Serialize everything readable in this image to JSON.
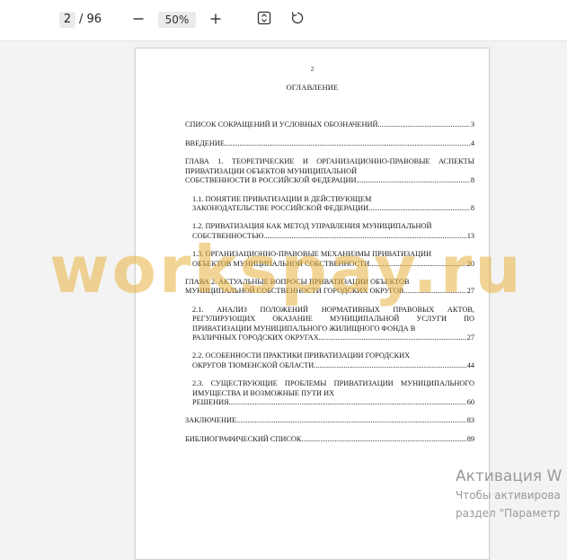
{
  "toolbar": {
    "page_current": "2",
    "page_total": "/ 96",
    "zoom_level": "50%",
    "icons": [
      "minus-icon",
      "plus-icon",
      "fit-page-icon",
      "rotate-icon"
    ]
  },
  "document": {
    "page_number": "2",
    "title": "ОГЛАВЛЕНИЕ",
    "toc": [
      {
        "lead": "",
        "last": "СПИСОК СОКРАЩЕНИЙ И УСЛОВНЫХ ОБОЗНАЧЕНИЙ",
        "page": "3",
        "sub": false
      },
      {
        "lead": "",
        "last": "ВВЕДЕНИЕ",
        "page": "4",
        "sub": false
      },
      {
        "lead": "ГЛАВА 1. ТЕОРЕТИЧЕСКИЕ И ОРГАНИЗАЦИОННО-ПРАВОВЫЕ АСПЕКТЫ ПРИВАТИЗАЦИИ ОБЪЕКТОВ МУНИЦИПАЛЬНОЙ",
        "last": "СОБСТВЕННОСТИ В РОССИЙСКОЙ ФЕДЕРАЦИИ.",
        "page": "8",
        "sub": false
      },
      {
        "lead": "1.1. ПОНЯТИЕ ПРИВАТИЗАЦИИ В ДЕЙСТВУЮЩЕМ",
        "last": "ЗАКОНОДАТЕЛЬСТВЕ РОССИЙСКОЙ ФЕДЕРАЦИИ.",
        "page": "8",
        "sub": true
      },
      {
        "lead": "1.2. ПРИВАТИЗАЦИЯ КАК МЕТОД УПРАВЛЕНИЯ МУНИЦИПАЛЬНОЙ",
        "last": "СОБСТВЕННОСТЬЮ.",
        "page": "13",
        "sub": true
      },
      {
        "lead": "1.3. ОРГАНИЗАЦИОННО-ПРАВОВЫЕ МЕХАНИЗМЫ ПРИВАТИЗАЦИИ",
        "last": "ОБЪЕКТОВ МУНИЦИПАЛЬНОЙ СОБСТВЕННОСТИ.",
        "page": "20",
        "sub": true
      },
      {
        "lead": "ГЛАВА 2. АКТУАЛЬНЫЕ ВОПРОСЫ ПРИВАТИЗАЦИИ ОБЪЕКТОВ",
        "last": "МУНИЦИПАЛЬНОЙ СОБСТВЕННОСТИ ГОРОДСКИХ ОКРУГОВ",
        "page": "27",
        "sub": false
      },
      {
        "lead": "2.1. АНАЛИЗ ПОЛОЖЕНИЙ НОРМАТИВНЫХ ПРАВОВЫХ АКТОВ, РЕГУЛИРУЮЩИХ ОКАЗАНИЕ МУНИЦИПАЛЬНОЙ УСЛУГИ ПО ПРИВАТИЗАЦИИ МУНИЦИПАЛЬНОГО ЖИЛИЩНОГО ФОНДА В",
        "last": "РАЗЛИЧНЫХ ГОРОДСКИХ ОКРУГАХ.",
        "page": "27",
        "sub": true
      },
      {
        "lead": "2.2. ОСОБЕННОСТИ ПРАКТИКИ ПРИВАТИЗАЦИИ ГОРОДСКИХ",
        "last": "ОКРУГОВ ТЮМЕНСКОЙ ОБЛАСТИ.",
        "page": "44",
        "sub": true
      },
      {
        "lead": "2.3. СУЩЕСТВУЮЩИЕ ПРОБЛЕМЫ ПРИВАТИЗАЦИИ МУНИЦИПАЛЬНОГО ИМУЩЕСТВА И ВОЗМОЖНЫЕ ПУТИ ИХ",
        "last": "РЕШЕНИЯ.",
        "page": "60",
        "sub": true
      },
      {
        "lead": "",
        "last": "ЗАКЛЮЧЕНИЕ",
        "page": "83",
        "sub": false
      },
      {
        "lead": "",
        "last": "БИБЛИОГРАФИЧЕСКИЙ СПИСОК",
        "page": "89",
        "sub": false
      }
    ]
  },
  "watermark": "workspay.ru",
  "activation": {
    "title": "Активация W",
    "line1": "Чтобы активирова",
    "line2": "раздел \"Параметр"
  },
  "colors": {
    "background": "#f3f3f3",
    "toolbar": "#ffffff",
    "watermark": "#e8b240",
    "activation_text": "#9a9a9a"
  }
}
